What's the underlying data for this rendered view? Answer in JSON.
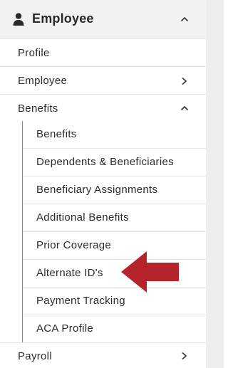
{
  "section": {
    "icon": "person-icon",
    "title": "Employee",
    "toggle_icon": "chevron-up-icon"
  },
  "menu": {
    "profile": "Profile",
    "employee": "Employee",
    "benefits": "Benefits",
    "payroll": "Payroll"
  },
  "benefits_submenu": [
    "Benefits",
    "Dependents & Beneficiaries",
    "Beneficiary Assignments",
    "Additional Benefits",
    "Prior Coverage",
    "Alternate ID's",
    "Payment Tracking",
    "ACA Profile"
  ],
  "annotation": {
    "icon": "arrow-left-icon",
    "color": "#b5242a"
  }
}
